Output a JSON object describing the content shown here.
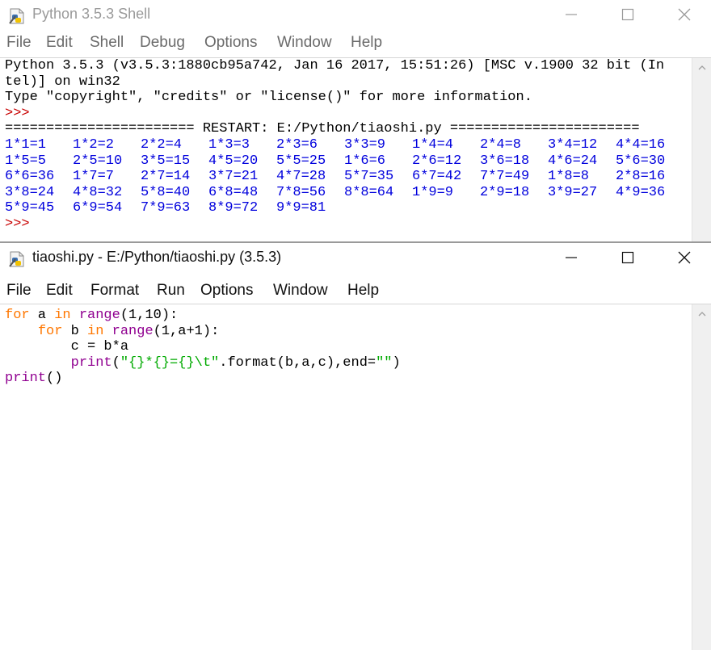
{
  "shell": {
    "title": "Python 3.5.3 Shell",
    "menus": [
      "File",
      "Edit",
      "Shell",
      "Debug",
      "Options",
      "Window",
      "Help"
    ],
    "banner": [
      "Python 3.5.3 (v3.5.3:1880cb95a742, Jan 16 2017, 15:51:26) [MSC v.1900 32 bit (In",
      "tel)] on win32",
      "Type \"copyright\", \"credits\" or \"license()\" for more information."
    ],
    "prompt": ">>>",
    "restart": "======================= RESTART: E:/Python/tiaoshi.py =======================",
    "output_rows": [
      [
        "1*1=1",
        "1*2=2",
        "2*2=4",
        "1*3=3",
        "2*3=6",
        "3*3=9",
        "1*4=4",
        "2*4=8",
        "3*4=12",
        "4*4=16"
      ],
      [
        "1*5=5",
        "2*5=10",
        "3*5=15",
        "4*5=20",
        "5*5=25",
        "1*6=6",
        "2*6=12",
        "3*6=18",
        "4*6=24",
        "5*6=30"
      ],
      [
        "6*6=36",
        "1*7=7",
        "2*7=14",
        "3*7=21",
        "4*7=28",
        "5*7=35",
        "6*7=42",
        "7*7=49",
        "1*8=8",
        "2*8=16"
      ],
      [
        "3*8=24",
        "4*8=32",
        "5*8=40",
        "6*8=48",
        "7*8=56",
        "8*8=64",
        "1*9=9",
        "2*9=18",
        "3*9=27",
        "4*9=36"
      ],
      [
        "5*9=45",
        "6*9=54",
        "7*9=63",
        "8*9=72",
        "9*9=81"
      ]
    ],
    "final_prompt": ">>>"
  },
  "editor": {
    "title": "tiaoshi.py - E:/Python/tiaoshi.py (3.5.3)",
    "menus": [
      "File",
      "Edit",
      "Format",
      "Run",
      "Options",
      "Window",
      "Help"
    ],
    "code": {
      "l1_kw1": "for",
      "l1_var": " a ",
      "l1_kw2": "in",
      "l1_sp": " ",
      "l1_fn": "range",
      "l1_rest": "(1,10):",
      "l2_indent": "    ",
      "l2_kw1": "for",
      "l2_var": " b ",
      "l2_kw2": "in",
      "l2_sp": " ",
      "l2_fn": "range",
      "l2_rest": "(1,a+1):",
      "l3": "        c = b*a",
      "l4_indent": "        ",
      "l4_fn": "print",
      "l4_paren": "(",
      "l4_str": "\"{}*{}={}\\t\"",
      "l4_mid": ".format(b,a,c),end=",
      "l4_str2": "\"\"",
      "l4_end": ")",
      "l5_fn": "print",
      "l5_rest": "()"
    }
  },
  "colors": {
    "keyword": "#ff7700",
    "builtin": "#900090",
    "string": "#00aa00",
    "output": "#0000dd",
    "prompt": "#c80000"
  }
}
